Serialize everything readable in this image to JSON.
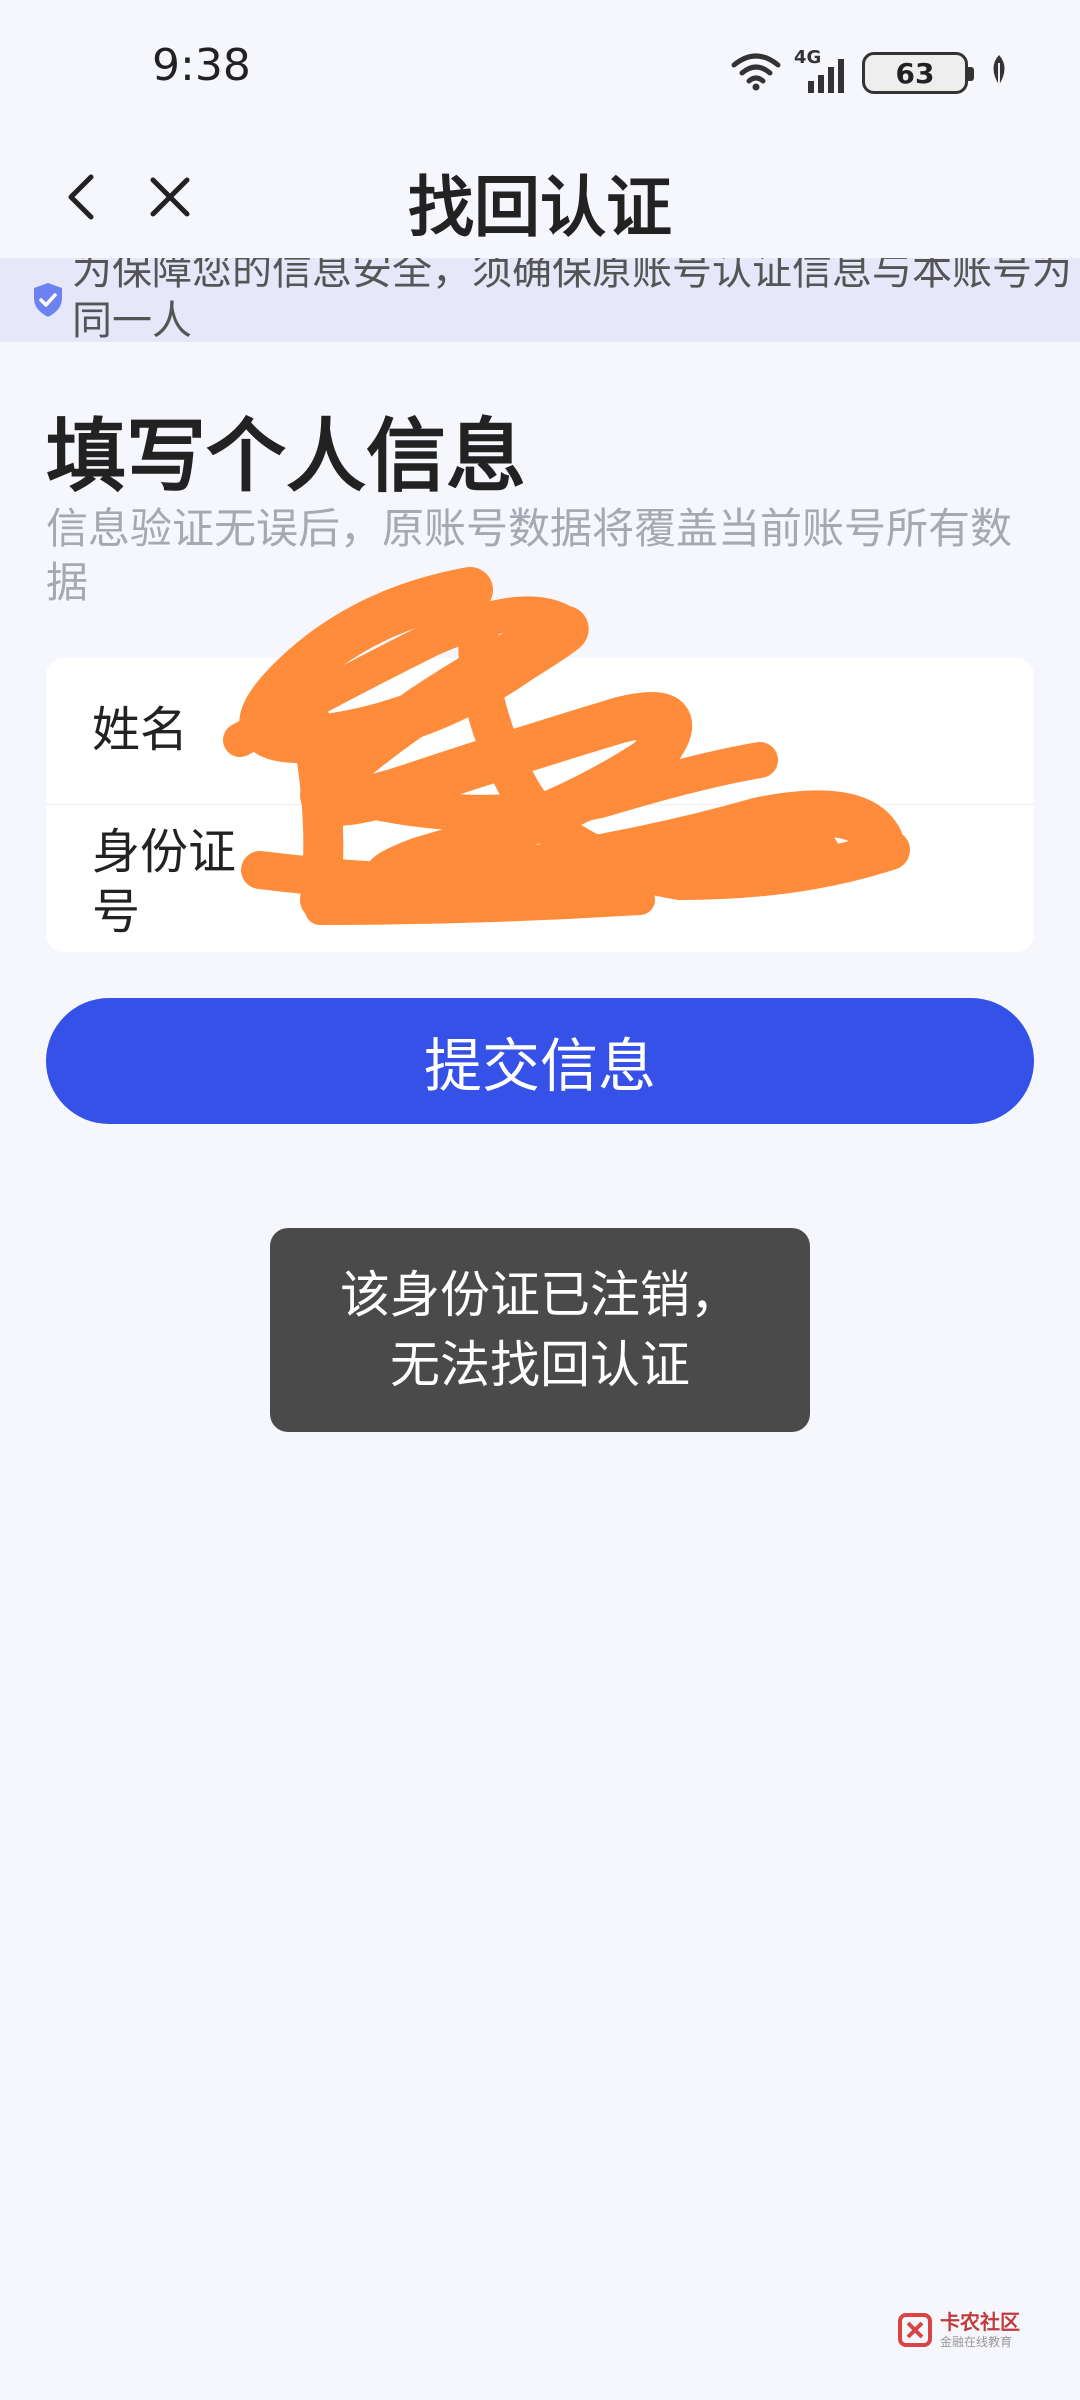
{
  "status_bar": {
    "time": "9:38",
    "network": "4G",
    "battery_level": "63",
    "icons": [
      "wifi-icon",
      "signal-icon",
      "battery-icon",
      "leaf-icon"
    ]
  },
  "navbar": {
    "title": "找回认证",
    "back_icon": "chevron-left-icon",
    "close_icon": "close-icon"
  },
  "notice": {
    "icon": "shield-check-icon",
    "text": "为保障您的信息安全，须确保原账号认证信息与本账号为同一人"
  },
  "form": {
    "title": "填写个人信息",
    "subtitle": "信息验证无误后，原账号数据将覆盖当前账号所有数据",
    "name_label": "姓名",
    "name_value": "",
    "id_label": "身份证号",
    "id_value": "",
    "submit_label": "提交信息"
  },
  "toast": {
    "line1": "该身份证已注销，",
    "line2": "无法找回认证"
  },
  "watermark": {
    "title": "卡农社区",
    "subtitle": "金融在线教育"
  },
  "colors": {
    "background": "#f6f7fd",
    "accent": "#3651e7",
    "notice_bg": "#e6e8fa",
    "toast_bg": "#4a4a4a",
    "redaction": "#ff8c3a"
  }
}
